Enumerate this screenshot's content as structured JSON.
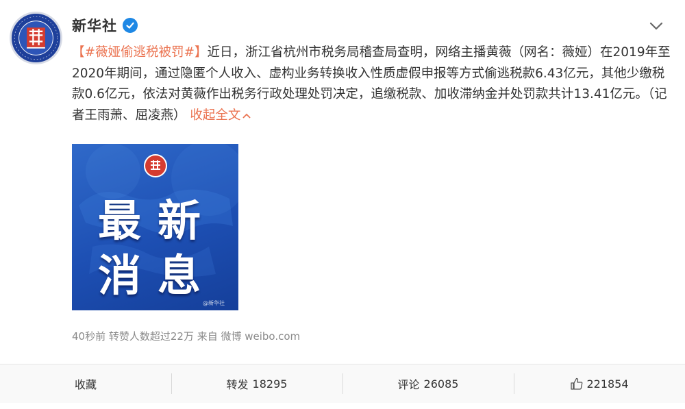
{
  "account": {
    "name": "新华社",
    "avatar_icon": "xinhua-logo-icon",
    "verified_icon": "verified-badge-icon"
  },
  "post": {
    "hashtag": "【#薇娅偷逃税被罚#】",
    "body": "近日，浙江省杭州市税务局稽查局查明，网络主播黄薇（网名：薇娅）在2019年至2020年期间，通过隐匿个人收入、虚构业务转换收入性质虚假申报等方式偷逃税款6.43亿元，其他少缴税款0.6亿元，依法对黄薇作出税务行政处理处罚决定，追缴税款、加收滞纳金并处罚款共计13.41亿元。（记者王雨萧、屈凌燕）",
    "collapse_label": "收起全文",
    "image": {
      "line1": "最新",
      "line2": "消息",
      "watermark": "@新华社"
    },
    "meta": "40秒前 转赞人数超过22万 来自 微博 weibo.com"
  },
  "footer": {
    "collect_label": "收藏",
    "repost_label": "转发",
    "repost_count": "18295",
    "comment_label": "评论",
    "comment_count": "26085",
    "like_count": "221854"
  },
  "colors": {
    "hashtag": "#eb7350",
    "image_blue": "#1d4fb3",
    "avatar_blue": "#1e3f9a",
    "verified_blue": "#1e88e5"
  }
}
